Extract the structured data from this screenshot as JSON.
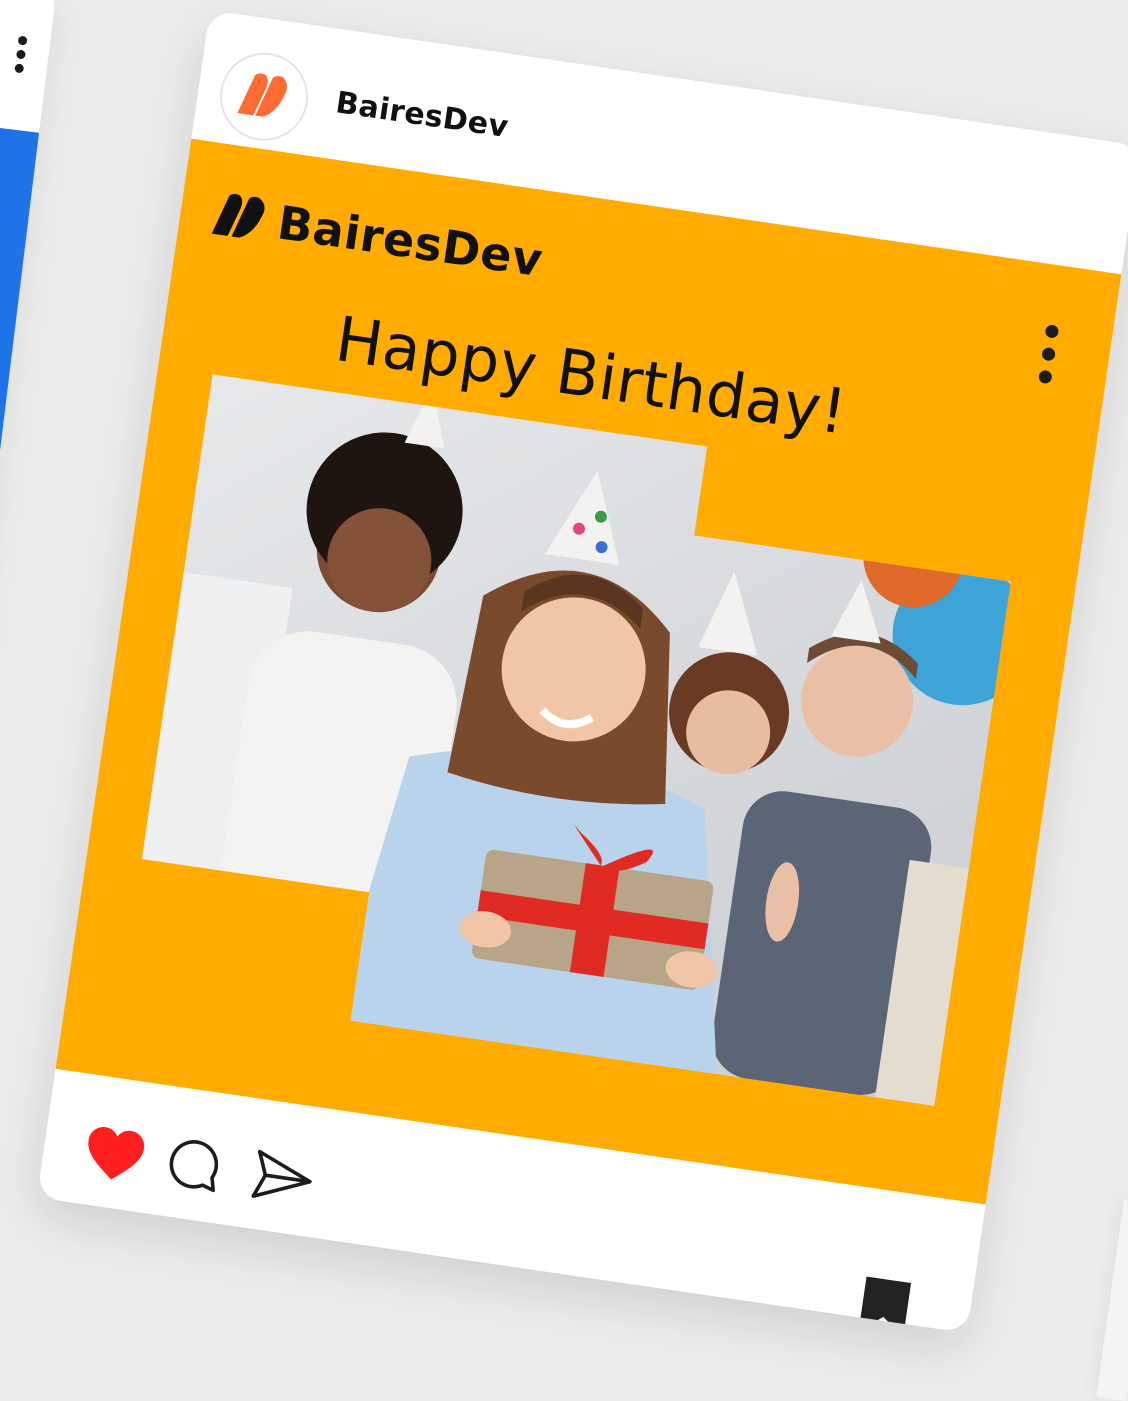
{
  "post": {
    "account_name": "BairesDev",
    "brand_name": "BairesDev",
    "headline": "Happy Birthday!",
    "liked": true
  },
  "colors": {
    "brand_orange": "#ff6b35",
    "post_background": "#ffab00",
    "like_red": "#ff1f1f",
    "neighbour_card_blue": "#1f73e8"
  },
  "icons": {
    "more": "more-vertical-icon",
    "like": "heart-icon",
    "comment": "comment-bubble-icon",
    "share": "paper-plane-icon",
    "save": "bookmark-icon"
  }
}
